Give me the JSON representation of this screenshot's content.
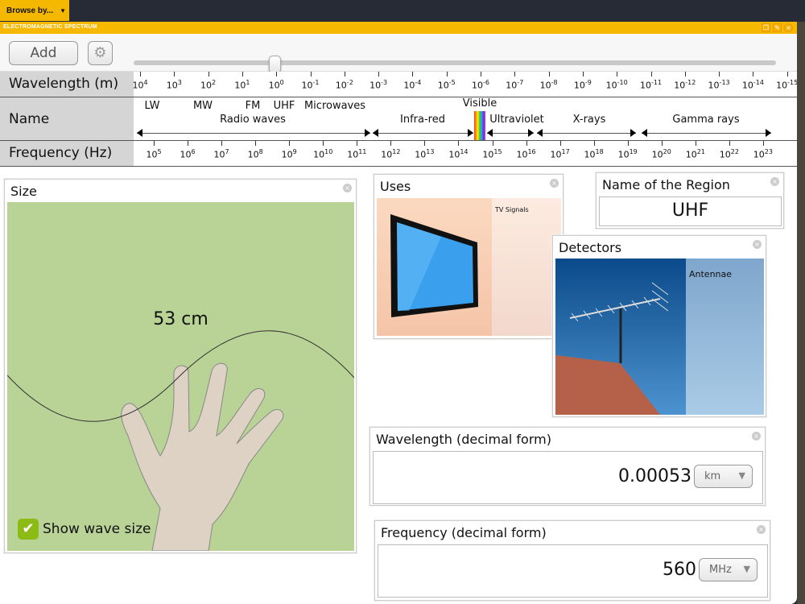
{
  "topbar": {
    "browse_label": "Browse by...",
    "browse_icon": "caret-down-icon"
  },
  "window": {
    "title": "ELECTROMAGNETIC SPECTRUM"
  },
  "toolbar": {
    "add_label": "Add",
    "settings_icon": "gear-icon",
    "slider_value_fraction": 0.22
  },
  "scale": {
    "wavelength_label": "Wavelength (m)",
    "wavelength_exponents": [
      "4",
      "3",
      "2",
      "1",
      "0",
      "-1",
      "-2",
      "-3",
      "-4",
      "-5",
      "-6",
      "-7",
      "-8",
      "-9",
      "-10",
      "-11",
      "-12",
      "-13",
      "-14",
      "-15"
    ],
    "name_label": "Name",
    "sub_names": [
      "LW",
      "MW",
      "FM",
      "UHF",
      "Microwaves"
    ],
    "regions": [
      "Radio waves",
      "Infra-red",
      "Visible",
      "Ultraviolet",
      "X-rays",
      "Gamma rays"
    ],
    "frequency_label": "Frequency (Hz)",
    "frequency_exponents": [
      "5",
      "6",
      "7",
      "8",
      "9",
      "10",
      "11",
      "12",
      "13",
      "14",
      "15",
      "16",
      "17",
      "18",
      "19",
      "20",
      "21",
      "22",
      "23"
    ]
  },
  "size_panel": {
    "title": "Size",
    "measurement": "53 cm",
    "checkbox_label": "Show wave size",
    "checkbox_checked": true,
    "bg_color": "#b9d396"
  },
  "uses_panel": {
    "title": "Uses",
    "caption": "TV Signals"
  },
  "region_panel": {
    "title": "Name of the Region",
    "value": "UHF"
  },
  "detectors_panel": {
    "title": "Detectors",
    "caption": "Antennae"
  },
  "wavelength_panel": {
    "title": "Wavelength (decimal form)",
    "value": "0.00053",
    "unit": "km"
  },
  "frequency_panel": {
    "title": "Frequency (decimal form)",
    "value": "560",
    "unit": "MHz"
  },
  "colors": {
    "accent": "#f7b900",
    "topbar": "#262b35"
  }
}
